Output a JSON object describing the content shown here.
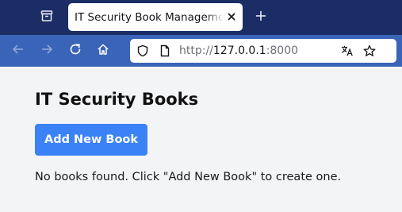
{
  "browser": {
    "tab": {
      "title": "IT Security Book Management",
      "close_icon": "close-icon"
    },
    "icons": {
      "tab_overview": "tab-overview-icon",
      "new_tab": "plus-icon",
      "back": "back-arrow-icon",
      "forward": "forward-arrow-icon",
      "reload": "reload-icon",
      "home": "home-icon",
      "tracking_protection": "shield-icon",
      "page_info": "page-icon",
      "translate": "translate-icon",
      "bookmark": "star-icon"
    },
    "url": {
      "scheme": "http://",
      "host": "127.0.0.1",
      "port": ":8000"
    }
  },
  "page": {
    "title": "IT Security Books",
    "add_button_label": "Add New Book",
    "empty_message": "No books found. Click \"Add New Book\" to create one."
  },
  "colors": {
    "tabstrip": "#1c2d66",
    "navbar": "#3a64b8",
    "page_background": "#f3f4f6",
    "accent_button": "#3b82f6"
  }
}
